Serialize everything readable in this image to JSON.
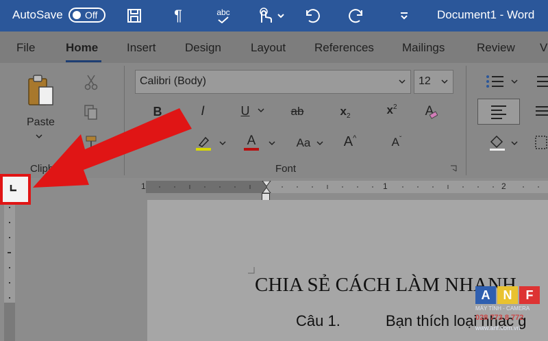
{
  "titlebar": {
    "autosave_label": "AutoSave",
    "autosave_state": "Off",
    "undo_dropdown": "abc",
    "document_title": "Document1  -  Word"
  },
  "tabs": [
    "File",
    "Home",
    "Insert",
    "Design",
    "Layout",
    "References",
    "Mailings",
    "Review",
    "V"
  ],
  "ribbon": {
    "paste_label": "Paste",
    "clipboard_label": "Clipbo",
    "font_label": "Font",
    "font_name": "Calibri (Body)",
    "font_size": "12",
    "font_buttons": {
      "bold": "B",
      "italic": "I",
      "underline": "U",
      "strike": "ab",
      "subscript": "x",
      "subscript_mark": "2",
      "superscript": "x",
      "superscript_mark": "2",
      "change_case": "Aa",
      "grow_font": "A",
      "shrink_font": "A",
      "font_color": "A",
      "text_effects": "A"
    }
  },
  "ruler": {
    "top_labels": [
      "1",
      "1",
      "2"
    ]
  },
  "document": {
    "heading": "CHIA SẺ CÁCH LÀM NHANH",
    "question_number": "Câu 1.",
    "question_text": "Bạn thích loại nhạc g"
  },
  "watermark": {
    "letters": [
      "A",
      "N",
      "F"
    ],
    "subtitle": "MÁY TÍNH - CAMERA",
    "phone": "028 773 8 772",
    "url": "www.anf.com.vn"
  },
  "colors": {
    "titlebar": "#2b579a",
    "highlight": "#e01515",
    "arrow": "#e01515"
  }
}
